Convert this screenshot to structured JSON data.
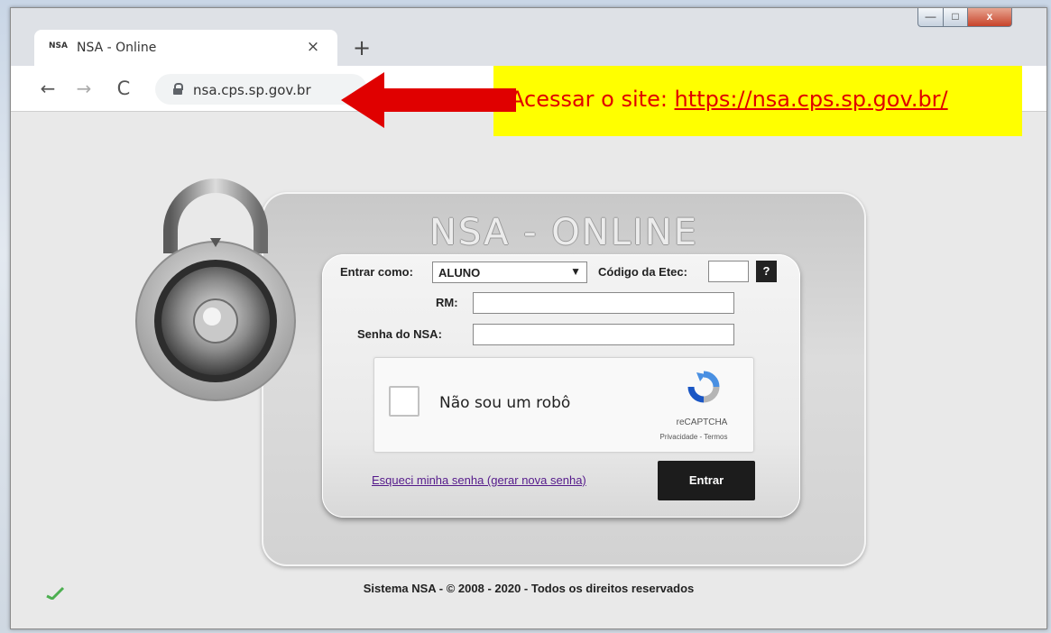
{
  "browser": {
    "tab_title": "NSA - Online",
    "tab_favicon_text": "NSA",
    "tab_close": "×",
    "new_tab": "+",
    "nav_back": "←",
    "nav_forward": "→",
    "nav_reload": "C",
    "address": "nsa.cps.sp.gov.br",
    "window_buttons": {
      "minimize": "—",
      "maximize": "□",
      "close": "x"
    }
  },
  "annotation": {
    "text_prefix": "Acessar o site: ",
    "link": "https://nsa.cps.sp.gov.br/",
    "background_color": "#ffff00",
    "text_color": "#e00000",
    "arrow_color": "#e00000"
  },
  "login": {
    "title": "NSA - ONLINE",
    "role_label": "Entrar como:",
    "role_value": "ALUNO",
    "etec_label": "Código da Etec:",
    "etec_value": "",
    "help_button": "?",
    "rm_label": "RM:",
    "rm_value": "",
    "password_label": "Senha do NSA:",
    "password_value": "",
    "captcha_label": "Não sou um robô",
    "captcha_brand": "reCAPTCHA",
    "captcha_links": "Privacidade - Termos",
    "forgot_link": "Esqueci minha senha (gerar nova senha)",
    "submit_button": "Entrar"
  },
  "footer": {
    "text": "Sistema NSA  -  © 2008 - 2020  -  Todos os direitos reservados"
  },
  "icons": [
    "favicon-icon",
    "close-tab-icon",
    "new-tab-icon",
    "back-icon",
    "forward-icon",
    "reload-icon",
    "lock-icon",
    "red-arrow-icon",
    "padlock-image",
    "dropdown-chevron-icon",
    "recaptcha-logo-icon",
    "checkmark-icon"
  ]
}
